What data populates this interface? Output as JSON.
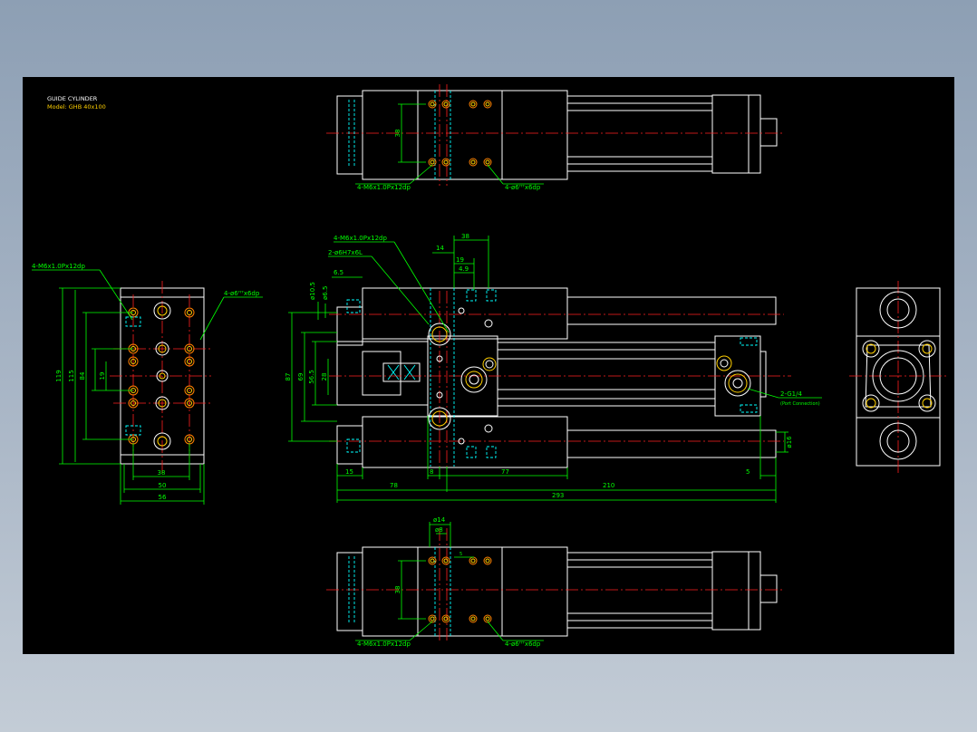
{
  "title_block": {
    "title": "GUIDE CYLINDER",
    "model": "Model: GHB 40x100"
  },
  "colors": {
    "background": "#000000",
    "outline": "#ffffff",
    "dimension": "#00ff00",
    "centerline": "#ff2020",
    "hidden": "#00ffff",
    "hole_inner": "#ffd000",
    "hole_outer": "#ff8000"
  },
  "top_view": {
    "callout_left": "4-M6x1.0Px12dp",
    "callout_right": "4-ø6ᴴ⁷x6dp",
    "dim_vertical": "38"
  },
  "front_view": {
    "callout_m6": "4-M6x1.0Px12dp",
    "callout_pin": "2-ø6H7x6L",
    "dims": {
      "d38": "38",
      "d14": "14",
      "d19": "19",
      "d49": "4.9",
      "d65a": "6.5",
      "d105": "ø10.5",
      "d65b": "ø6.5",
      "d87": "87",
      "d69": "69",
      "d565": "56.5",
      "d28": "28",
      "d16": "ø16",
      "d15": "15",
      "d8": "8",
      "d77": "77",
      "d5": "5",
      "d78": "78",
      "d210": "210",
      "d293": "293"
    },
    "port_callout": "2-G1/4",
    "port_note": "(Port Connection)"
  },
  "side_view": {
    "callout_m6": "4-M6x1.0Px12dp",
    "callout_pin": "4-ø6ᴴ⁷x6dp",
    "dims": {
      "d119": "119",
      "d115": "115",
      "d84": "84",
      "d19": "19",
      "d38": "38",
      "d50": "50",
      "d56": "56"
    }
  },
  "bottom_view": {
    "callout_left": "4-M6x1.0Px12dp",
    "callout_right": "4-ø6ᴴ⁷x6dp",
    "dim_vertical": "38",
    "dim_pin": "ø14",
    "dim_pin2": "ø8",
    "dim_small": "5"
  }
}
